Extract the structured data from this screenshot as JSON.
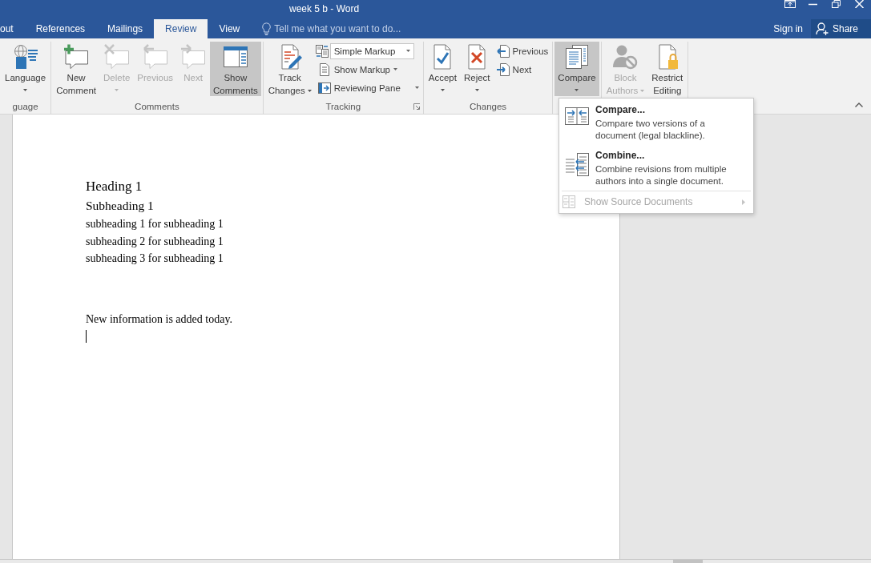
{
  "window": {
    "title": "week 5 b - Word"
  },
  "tabs": [
    {
      "label": "out",
      "selected": false
    },
    {
      "label": "References",
      "selected": false
    },
    {
      "label": "Mailings",
      "selected": false
    },
    {
      "label": "Review",
      "selected": true
    },
    {
      "label": "View",
      "selected": false
    }
  ],
  "tell_me": {
    "placeholder": "Tell me what you want to do..."
  },
  "account": {
    "sign_in": "Sign in",
    "share": "Share"
  },
  "ribbon": {
    "groups": [
      {
        "label": "guage",
        "items": [
          {
            "kind": "large",
            "lines": [
              "Language"
            ],
            "dropdown": true,
            "disabled": false,
            "pressed": false
          }
        ]
      },
      {
        "label": "Comments",
        "items": [
          {
            "kind": "large",
            "lines": [
              "New",
              "Comment"
            ],
            "dropdown": false,
            "disabled": false,
            "pressed": false
          },
          {
            "kind": "large",
            "lines": [
              "Delete"
            ],
            "dropdown": true,
            "disabled": true,
            "pressed": false
          },
          {
            "kind": "large",
            "lines": [
              "Previous"
            ],
            "dropdown": false,
            "disabled": true,
            "pressed": false
          },
          {
            "kind": "large",
            "lines": [
              "Next"
            ],
            "dropdown": false,
            "disabled": true,
            "pressed": false
          },
          {
            "kind": "large",
            "lines": [
              "Show",
              "Comments"
            ],
            "dropdown": false,
            "disabled": false,
            "pressed": true
          }
        ]
      },
      {
        "label": "Tracking",
        "launcher": true,
        "items": [
          {
            "kind": "large",
            "lines": [
              "Track",
              "Changes"
            ],
            "dropdown": true,
            "disabled": false,
            "pressed": false
          },
          {
            "kind": "select",
            "lines": [
              "Simple Markup"
            ],
            "dropdown": true,
            "disabled": false,
            "pressed": false
          },
          {
            "kind": "small",
            "lines": [
              "Show Markup"
            ],
            "dropdown": true,
            "disabled": false,
            "pressed": false
          },
          {
            "kind": "small-split",
            "lines": [
              "Reviewing Pane"
            ],
            "dropdown": true,
            "disabled": false,
            "pressed": false
          }
        ]
      },
      {
        "label": "Changes",
        "items": [
          {
            "kind": "large",
            "lines": [
              "Accept"
            ],
            "dropdown": true,
            "disabled": false,
            "pressed": false
          },
          {
            "kind": "large",
            "lines": [
              "Reject"
            ],
            "dropdown": true,
            "disabled": false,
            "pressed": false
          },
          {
            "kind": "small",
            "lines": [
              "Previous"
            ],
            "dropdown": false,
            "disabled": false,
            "pressed": false
          },
          {
            "kind": "small",
            "lines": [
              "Next"
            ],
            "dropdown": false,
            "disabled": false,
            "pressed": false
          }
        ]
      },
      {
        "items": [
          {
            "kind": "large",
            "lines": [
              "Compare"
            ],
            "dropdown": true,
            "disabled": false,
            "pressed": true
          }
        ]
      },
      {
        "items": [
          {
            "kind": "large",
            "lines": [
              "Block",
              "Authors"
            ],
            "dropdown": true,
            "disabled": true,
            "pressed": false
          },
          {
            "kind": "large",
            "lines": [
              "Restrict",
              "Editing"
            ],
            "dropdown": false,
            "disabled": false,
            "pressed": false
          }
        ]
      }
    ]
  },
  "compare_menu": {
    "items": [
      {
        "kind": "command",
        "title": "Compare...",
        "description": [
          "Compare two versions of a",
          "document (legal blackline)."
        ],
        "disabled": false
      },
      {
        "kind": "command",
        "title": "Combine...",
        "description": [
          "Combine revisions from multiple",
          "authors into a single document."
        ],
        "disabled": false
      },
      {
        "kind": "submenu",
        "title": "Show Source Documents",
        "disabled": true
      }
    ]
  },
  "document": {
    "paragraphs": [
      {
        "kind": "heading1",
        "text": "Heading 1"
      },
      {
        "kind": "heading2",
        "text": "Subheading 1"
      },
      {
        "kind": "body",
        "text": "subheading 1 for subheading 1"
      },
      {
        "kind": "body",
        "text": "subheading 2 for subheading 1"
      },
      {
        "kind": "body",
        "text": "subheading 3 for subheading 1"
      },
      {
        "kind": "blank"
      },
      {
        "kind": "blank"
      },
      {
        "kind": "blank"
      },
      {
        "kind": "body",
        "text": "New information is added today."
      }
    ],
    "text_cursor": true
  }
}
